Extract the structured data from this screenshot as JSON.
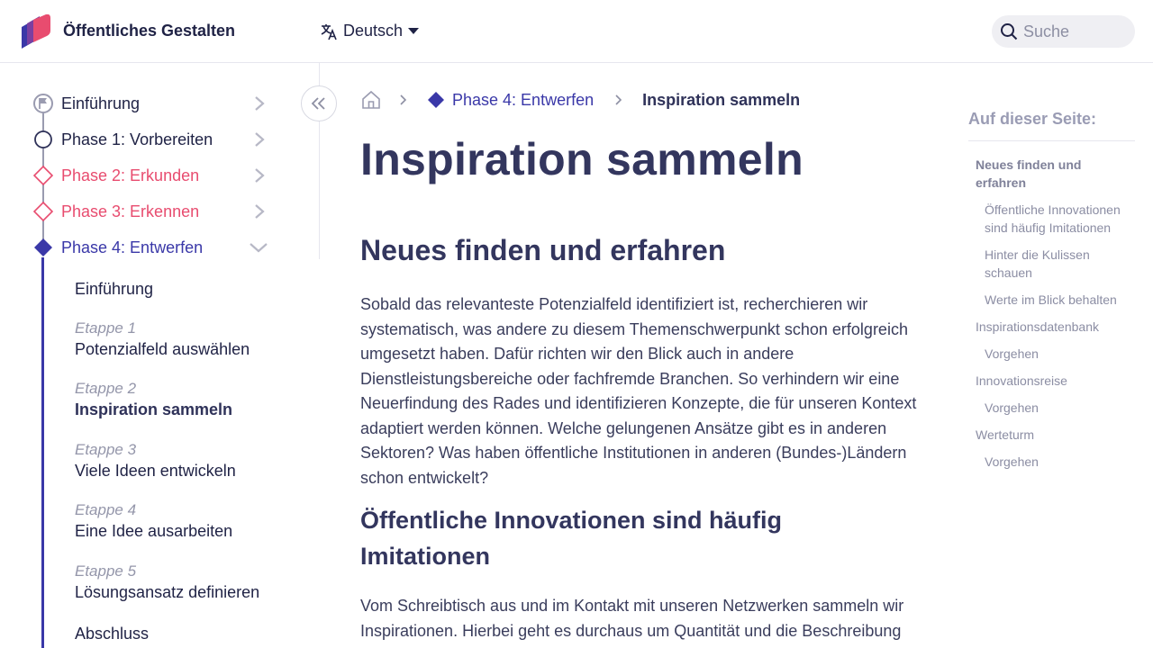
{
  "header": {
    "brand": "Öffentliches Gestalten",
    "language": "Deutsch",
    "search_placeholder": "Suche"
  },
  "colors": {
    "primary": "#3a38a8",
    "accent": "#e84c6f",
    "text": "#2f3259",
    "muted": "#9496aa"
  },
  "sidebar": {
    "phases": [
      {
        "label": "Einführung",
        "icon": "flag-icon"
      },
      {
        "label": "Phase 1: Vorbereiten",
        "icon": "circle-icon"
      },
      {
        "label": "Phase 2: Erkunden",
        "icon": "diamond-outline-icon"
      },
      {
        "label": "Phase 3: Erkennen",
        "icon": "diamond-outline-icon"
      },
      {
        "label": "Phase 4: Entwerfen",
        "icon": "diamond-filled-icon",
        "expanded": true
      }
    ],
    "subitems": [
      {
        "step": "",
        "name": "Einführung"
      },
      {
        "step": "Etappe 1",
        "name": "Potenzialfeld auswählen"
      },
      {
        "step": "Etappe 2",
        "name": "Inspiration sammeln",
        "active": true
      },
      {
        "step": "Etappe 3",
        "name": "Viele Ideen entwickeln"
      },
      {
        "step": "Etappe 4",
        "name": "Eine Idee ausarbeiten"
      },
      {
        "step": "Etappe 5",
        "name": "Lösungsansatz definieren"
      },
      {
        "step": "",
        "name": "Abschluss"
      }
    ]
  },
  "breadcrumb": {
    "phase": "Phase 4: Entwerfen",
    "current": "Inspiration sammeln"
  },
  "main": {
    "title": "Inspiration sammeln",
    "section1_heading": "Neues finden und erfahren",
    "section1_text": "Sobald das relevanteste Potenzialfeld identifiziert ist, recherchieren wir systematisch, was andere zu diesem Themenschwerpunkt schon erfolgreich umgesetzt haben. Dafür richten wir den Blick auch in andere Dienstleistungsbereiche oder fachfremde Branchen. So verhindern wir eine Neuerfindung des Rades und identifizieren Konzepte, die für unseren Kontext adaptiert werden können. Welche gelungenen Ansätze gibt es in anderen Sektoren? Was haben öffentliche Institutionen in anderen (Bundes-)Ländern schon entwickelt?",
    "section2_heading": "Öffentliche Innovationen sind häufig Imitationen",
    "section2_text": "Vom Schreibtisch aus und im Kontakt mit unseren Netzwerken sammeln wir Inspirationen. Hierbei geht es durchaus um Quantität und die Beschreibung"
  },
  "toc": {
    "title": "Auf dieser Seite:",
    "items": [
      {
        "label": "Neues finden und erfahren",
        "level": 1,
        "active": true
      },
      {
        "label": "Öffentliche Innovationen sind häufig Imitationen",
        "level": 2
      },
      {
        "label": "Hinter die Kulissen schauen",
        "level": 2
      },
      {
        "label": "Werte im Blick behalten",
        "level": 2
      },
      {
        "label": "Inspirationsdatenbank",
        "level": 1
      },
      {
        "label": "Vorgehen",
        "level": 2
      },
      {
        "label": "Innovationsreise",
        "level": 1
      },
      {
        "label": "Vorgehen",
        "level": 2
      },
      {
        "label": "Werteturm",
        "level": 1
      },
      {
        "label": "Vorgehen",
        "level": 2
      }
    ]
  }
}
